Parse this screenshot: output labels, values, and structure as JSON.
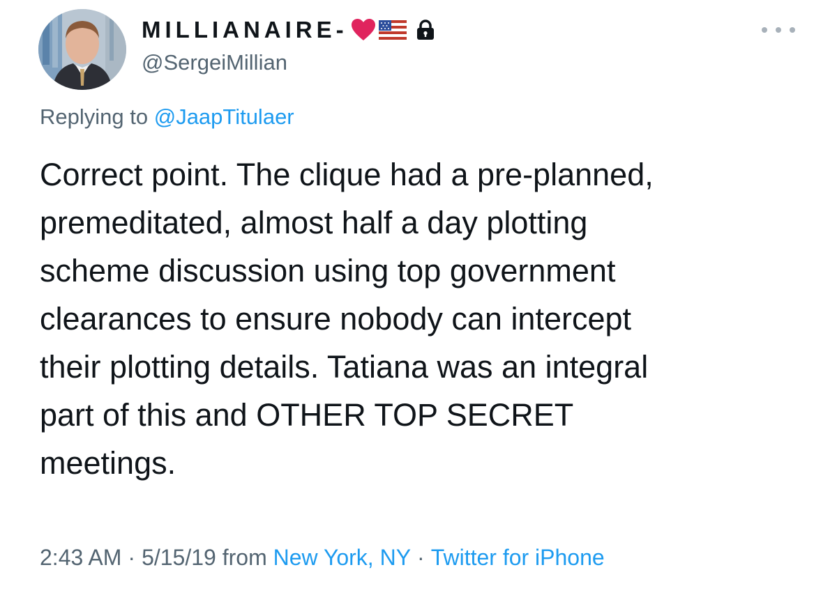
{
  "tweet": {
    "display_name": "MILLIANAIRE-",
    "display_name_emojis": [
      "heart-emoji",
      "us-flag-emoji",
      "lock-icon"
    ],
    "handle": "@SergeiMillian",
    "more_options_icon": "more-horizontal-icon",
    "replying_label": "Replying to ",
    "replying_to": "@JaapTitulaer",
    "body_lines": [
      "Correct point. The clique had a pre-planned,",
      "premeditated, almost half a day plotting",
      "scheme discussion using top government",
      "clearances to ensure nobody can intercept",
      "their plotting details. Tatiana was an integral",
      "part of this and OTHER TOP SECRET",
      "meetings."
    ],
    "time": "2:43 AM",
    "date": "5/15/19",
    "from_label": "from",
    "location": "New York, NY",
    "source": "Twitter for iPhone",
    "separator": "·"
  },
  "colors": {
    "text": "#0f1419",
    "secondary": "#536471",
    "link": "#1d9bf0",
    "heart": "#e0245e"
  }
}
